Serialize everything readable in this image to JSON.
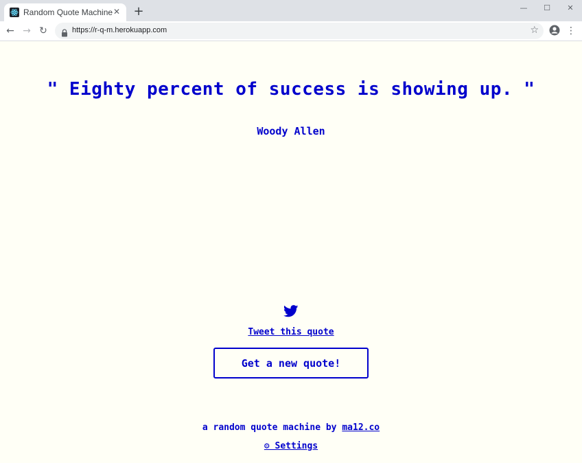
{
  "browser": {
    "tab_title": "Random Quote Machine",
    "tab_close_glyph": "✕",
    "new_tab_glyph": "+",
    "window_controls": {
      "minimize_glyph": "—",
      "maximize_glyph": "☐",
      "close_glyph": "✕"
    },
    "nav": {
      "back_glyph": "←",
      "forward_glyph": "→",
      "reload_glyph": "↻"
    },
    "url": "https://r-q-m.herokuapp.com",
    "star_glyph": "☆",
    "menu_glyph": "⋮",
    "icons": {
      "favicon": "react-atom-icon",
      "lock": "lock-icon",
      "profile": "account-circle-icon"
    }
  },
  "quote": {
    "text": "\" Eighty percent of success is showing up. \"",
    "author": "Woody Allen"
  },
  "actions": {
    "tweet_label": "Tweet this quote",
    "new_quote_label": "Get a new quote!",
    "tweet_icon": "twitter-bird-icon"
  },
  "footer": {
    "prefix": "a random quote machine by ",
    "link_label": "ma12.co",
    "settings_label": "⚙ Settings"
  },
  "colors": {
    "accent": "#0000cc",
    "background": "#fffff6"
  }
}
